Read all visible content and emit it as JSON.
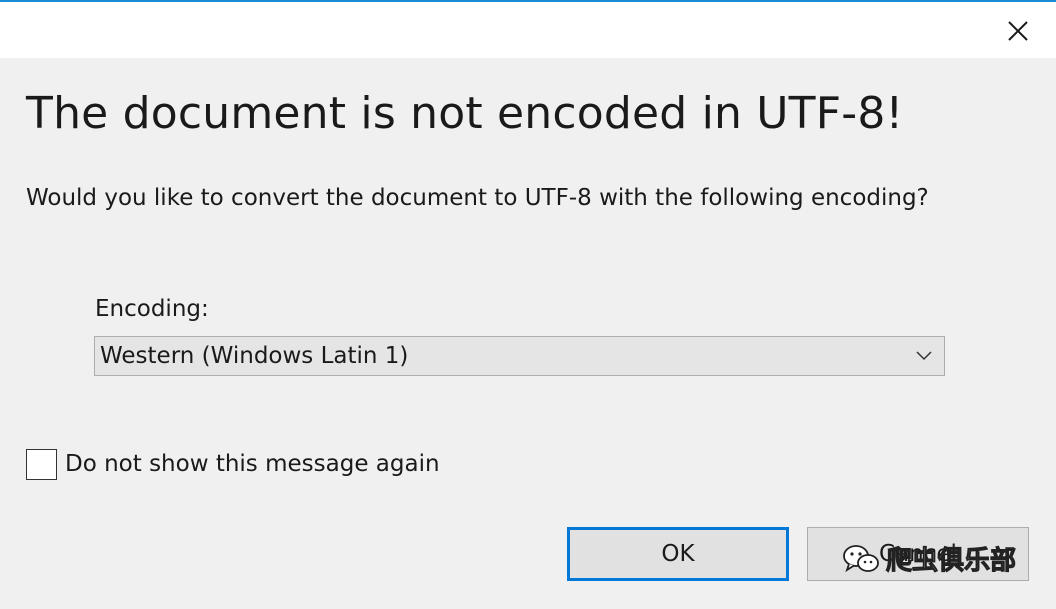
{
  "dialog": {
    "heading": "The document is not encoded in UTF-8!",
    "prompt": "Would you like to convert the document to UTF-8 with the following encoding?",
    "encoding_label": "Encoding:",
    "encoding_selected": "Western (Windows Latin 1)",
    "checkbox_label": "Do not show this message again",
    "checkbox_checked": false,
    "ok_label": "OK",
    "cancel_label": "Cancel"
  },
  "watermark": {
    "text": "爬虫俱乐部",
    "icon": "wechat-icon"
  },
  "colors": {
    "background": "#f0f0f0",
    "titlebar": "#ffffff",
    "accent": "#0078d7",
    "button": "#e1e1e1",
    "select": "#e5e5e5"
  }
}
